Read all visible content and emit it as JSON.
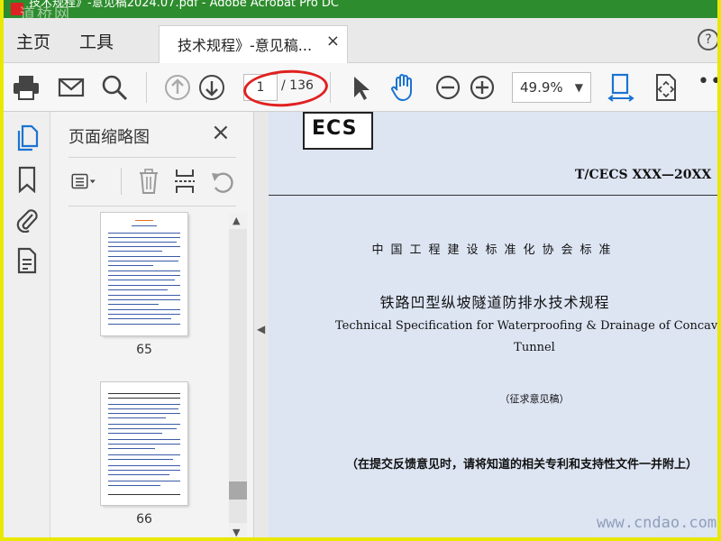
{
  "window": {
    "title": "技术规程》-意见稿2024.07.pdf - Adobe Acrobat Pro DC",
    "watermark_top": "道桥网"
  },
  "menubar": {
    "home_label": "主页",
    "tools_label": "工具",
    "tab_label": "技术规程》-意见稿...",
    "tab_close": "×",
    "help": "?"
  },
  "toolbar": {
    "icons": [
      "print-icon",
      "mail-icon",
      "search-icon",
      "page-up-icon",
      "page-down-icon",
      "select-arrow-icon",
      "hand-tool-icon",
      "zoom-out-icon",
      "zoom-in-icon",
      "fit-width-icon",
      "fit-page-icon",
      "more-icon"
    ],
    "page_current": "1",
    "page_total": "/ 136",
    "zoom_value": "49.9%",
    "more": "•••"
  },
  "leftrail": {
    "icons": [
      "pages-icon",
      "bookmark-icon",
      "attachment-icon",
      "document-icon"
    ]
  },
  "thumbnails_panel": {
    "title": "页面缩略图",
    "close": "×",
    "tools": [
      "options-icon",
      "delete-icon",
      "insert-icon",
      "rotate-icon"
    ],
    "pages": [
      {
        "label": "65"
      },
      {
        "label": "66"
      }
    ]
  },
  "document": {
    "logo_text": "ECS",
    "standard_code": "T/CECS XXX—20XX",
    "association": "中国工程建设标准化协会标准",
    "title_cn": "铁路凹型纵坡隧道防排水技术规程",
    "title_en_line1": "Technical Specification for Waterproofing & Drainage of Concave Slope Railwa",
    "title_en_line2": "Tunnel",
    "draft_note": "（征求意见稿）",
    "submission_note": "（在提交反馈意见时，请将知道的相关专利和支持性文件一并附上）"
  },
  "watermark_bottom": "www.cndao.com",
  "colors": {
    "title_bar": "#2d8c2d",
    "frame": "#e8e800",
    "annotation_oval": "#e02020",
    "doc_background": "#dde5f3"
  }
}
